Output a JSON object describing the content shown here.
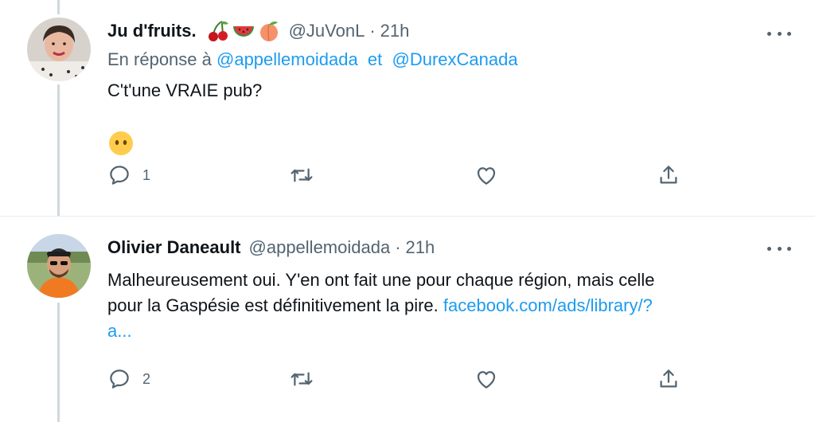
{
  "tweets": [
    {
      "author_name": "Ju d'fruits.",
      "name_emojis": [
        "cherries-icon",
        "watermelon-icon",
        "peach-icon"
      ],
      "handle": "@JuVonL",
      "separator": "·",
      "time": "21h",
      "reply_prefix": "En réponse à",
      "reply_to_1": "@appellemoidada",
      "reply_and": "et",
      "reply_to_2": "@DurexCanada",
      "text": "C't'une VRAIE pub?",
      "emoji": "no-mouth-face-icon",
      "reply_count": "1"
    },
    {
      "author_name": "Olivier Daneault",
      "handle": "@appellemoidada",
      "separator": "·",
      "time": "21h",
      "text_line_1": "Malheureusement oui. Y'en ont fait une pour chaque région, mais celle",
      "text_line_2": "pour la Gaspésie est définitivement la pire.",
      "link_part_1": "facebook.com/ads/library/?",
      "link_part_2": "a...",
      "reply_count": "2"
    }
  ],
  "colors": {
    "link": "#1d9bf0",
    "secondary_text": "#536471",
    "thread_line": "#cfd9de"
  }
}
